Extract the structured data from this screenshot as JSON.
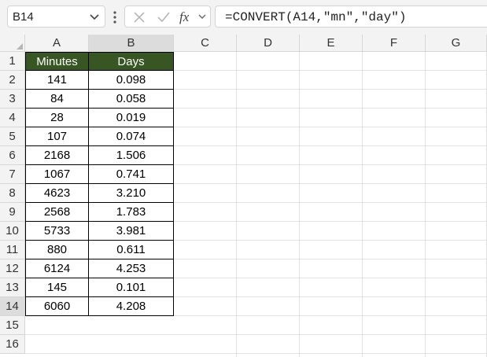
{
  "formula_bar": {
    "name_box": "B14",
    "formula": "=CONVERT(A14,\"mn\",\"day\")"
  },
  "columns": [
    "A",
    "B",
    "C",
    "D",
    "E",
    "F",
    "G"
  ],
  "rows": [
    "1",
    "2",
    "3",
    "4",
    "5",
    "6",
    "7",
    "8",
    "9",
    "10",
    "11",
    "12",
    "13",
    "14",
    "15",
    "16"
  ],
  "table": {
    "headers": [
      "Minutes",
      "Days"
    ],
    "rows": [
      [
        "141",
        "0.098"
      ],
      [
        "84",
        "0.058"
      ],
      [
        "28",
        "0.019"
      ],
      [
        "107",
        "0.074"
      ],
      [
        "2168",
        "1.506"
      ],
      [
        "1067",
        "0.741"
      ],
      [
        "4623",
        "3.210"
      ],
      [
        "2568",
        "1.783"
      ],
      [
        "5733",
        "3.981"
      ],
      [
        "880",
        "0.611"
      ],
      [
        "6124",
        "4.253"
      ],
      [
        "145",
        "0.101"
      ],
      [
        "6060",
        "4.208"
      ]
    ]
  },
  "colors": {
    "header_fill": "#375623",
    "header_text": "#ffffff"
  }
}
